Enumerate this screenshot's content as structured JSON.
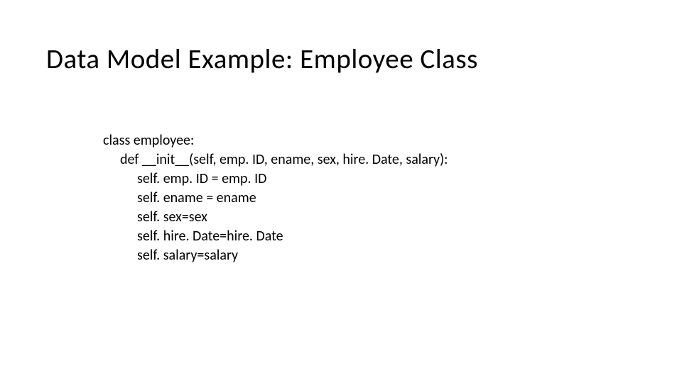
{
  "title": "Data Model Example: Employee Class",
  "code": {
    "line1": "class employee:",
    "line2": "def __init__(self, emp. ID, ename, sex, hire. Date, salary):",
    "line3": "self. emp. ID = emp. ID",
    "line4": "self. ename = ename",
    "line5": "self. sex=sex",
    "line6": "self. hire. Date=hire. Date",
    "line7": "self. salary=salary"
  }
}
